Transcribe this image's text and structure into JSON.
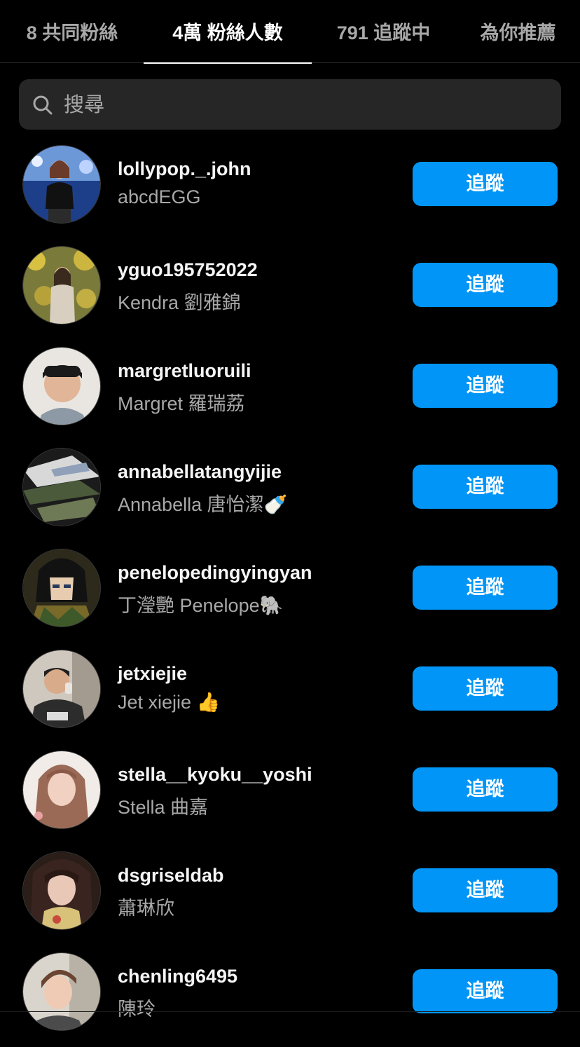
{
  "tabs": [
    {
      "label": "8 共同粉絲",
      "active": false
    },
    {
      "label": "4萬 粉絲人數",
      "active": true
    },
    {
      "label": "791 追蹤中",
      "active": false
    },
    {
      "label": "為你推薦",
      "active": false
    }
  ],
  "search": {
    "placeholder": "搜尋",
    "value": ""
  },
  "follow_label": "追蹤",
  "accent_color": "#0095f6",
  "users": [
    {
      "username": "lollypop._.john",
      "fullname": "abcdEGG"
    },
    {
      "username": "yguo195752022",
      "fullname": "Kendra 劉雅錦"
    },
    {
      "username": "margretluoruili",
      "fullname": "Margret 羅瑞荔"
    },
    {
      "username": "annabellatangyijie",
      "fullname": "Annabella 唐怡潔🍼"
    },
    {
      "username": "penelopedingyingyan",
      "fullname": "丁瀅艷 Penelope🐘"
    },
    {
      "username": "jetxiejie",
      "fullname": "Jet xiejie 👍"
    },
    {
      "username": "stella__kyoku__yoshi",
      "fullname": "Stella 曲嘉"
    },
    {
      "username": "dsgriseldab",
      "fullname": "蕭琳欣"
    },
    {
      "username": "chenling6495",
      "fullname": "陳玲"
    }
  ]
}
